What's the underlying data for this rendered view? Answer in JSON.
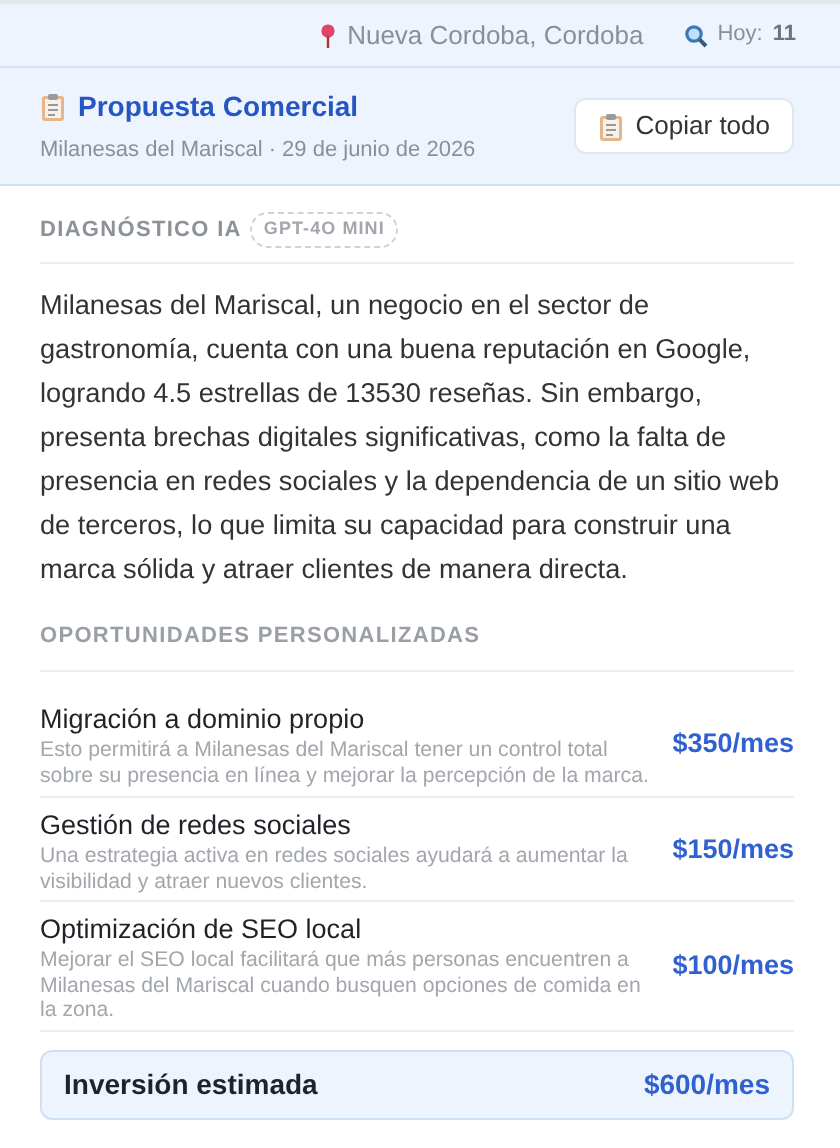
{
  "top_bar": {
    "location": "Nueva Cordoba, Cordoba",
    "today_label": "Hoy:",
    "today_count": "11"
  },
  "header": {
    "title": "Propuesta Comercial",
    "subtitle": "Milanesas del Mariscal · 29 de junio de 2026",
    "copy_button": "Copiar todo"
  },
  "diagnosis": {
    "heading": "DIAGNÓSTICO IA",
    "model_badge": "GPT-4O MINI",
    "text": "Milanesas del Mariscal, un negocio en el sector de gastronomía, cuenta con una buena reputación en Google, logrando 4.5 estrellas de 13530 reseñas. Sin embargo, presenta brechas digitales significativas, como la falta de presencia en redes sociales y la dependencia de un sitio web de terceros, lo que limita su capacidad para construir una marca sólida y atraer clientes de manera directa."
  },
  "opportunities": {
    "heading": "OPORTUNIDADES PERSONALIZADAS",
    "items": [
      {
        "title": "Migración a dominio propio",
        "description": "Esto permitirá a Milanesas del Mariscal tener un control total sobre su presencia en línea y mejorar la percepción de la marca.",
        "price": "$350/mes"
      },
      {
        "title": "Gestión de redes sociales",
        "description": "Una estrategia activa en redes sociales ayudará a aumentar la visibilidad y atraer nuevos clientes.",
        "price": "$150/mes"
      },
      {
        "title": "Optimización de SEO local",
        "description": "Mejorar el SEO local facilitará que más personas encuentren a Milanesas del Mariscal cuando busquen opciones de comida en la zona.",
        "price": "$100/mes"
      }
    ]
  },
  "total": {
    "label": "Inversión estimada",
    "value": "$600/mes"
  }
}
